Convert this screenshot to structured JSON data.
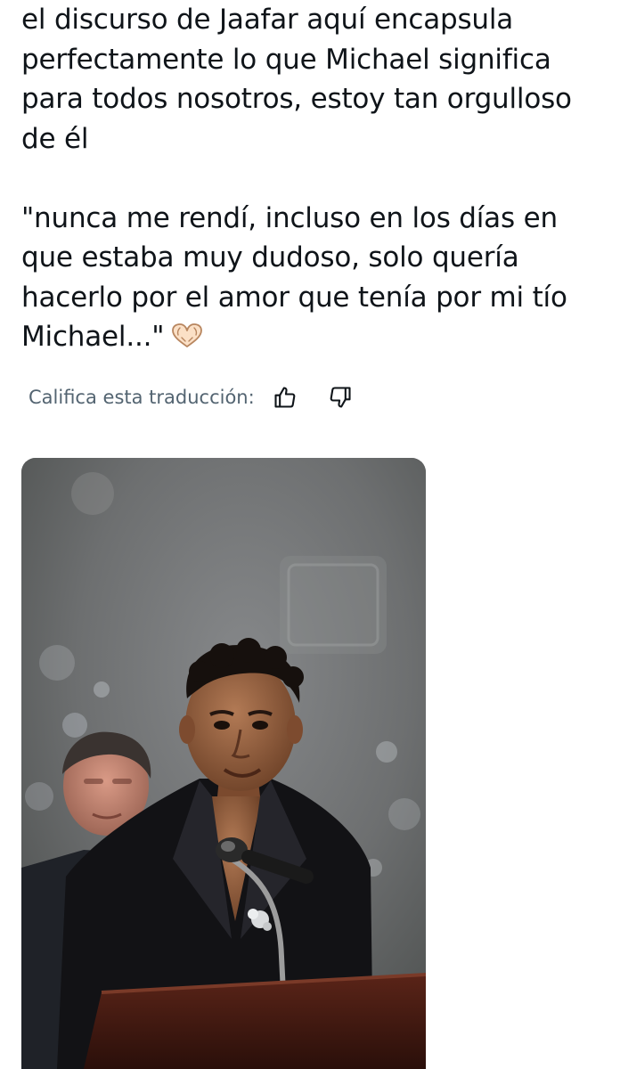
{
  "tweet": {
    "text_lines_1": "el discurso de Jaafar aquí encapsula perfectamente lo que Michael significa para todos nosotros, estoy tan orgulloso de él",
    "text_lines_2": "\"nunca me rendí, incluso en los días en que estaba muy dudoso, solo quería hacerlo por el amor que tenía por mi tío Michael...\"",
    "emoji": "heart-hands-emoji"
  },
  "translation_rating": {
    "label": "Califica esta traducción:",
    "like_icon": "thumbs-up-icon",
    "dislike_icon": "thumbs-down-icon"
  },
  "media": {
    "type": "photo",
    "subject": "man-speaking-at-podium"
  },
  "colors": {
    "text": "#0f1419",
    "secondary_text": "#536471",
    "background": "#ffffff"
  }
}
